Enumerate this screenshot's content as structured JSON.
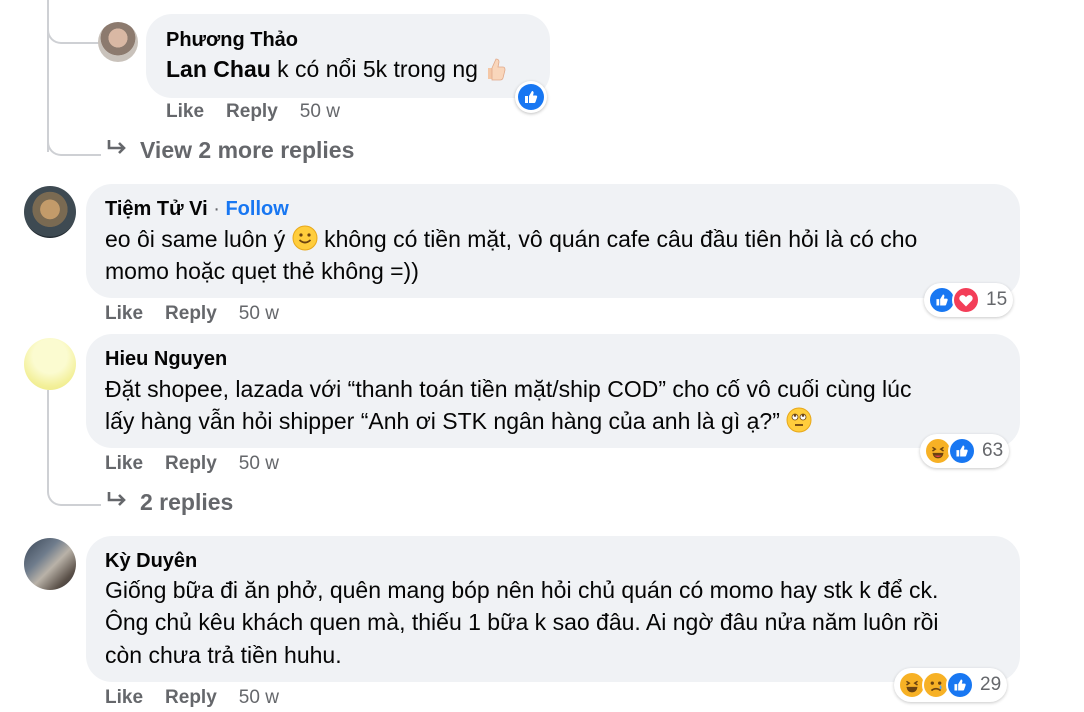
{
  "comments": {
    "reply_pt": {
      "author": "Phương Thảo",
      "mention": "Lan Chau",
      "text": "k có nổi 5k trong ng",
      "like": "Like",
      "reply": "Reply",
      "time": "50 w"
    },
    "view_more_pt": "View 2 more replies",
    "tiem": {
      "author": "Tiệm Tử Vi",
      "dot": "·",
      "follow": "Follow",
      "line1a": "eo ôi same luôn ý",
      "line1b": "không có tiền mặt, vô quán cafe câu đầu tiên hỏi là có cho",
      "line2": "momo hoặc quẹt thẻ không =))",
      "reaction_count": "15",
      "like": "Like",
      "reply": "Reply",
      "time": "50 w"
    },
    "hieu": {
      "author": "Hieu Nguyen",
      "line1": "Đặt shopee, lazada với “thanh toán tiền mặt/ship COD” cho cố vô cuối cùng lúc",
      "line2": "lấy hàng vẫn hỏi shipper “Anh ơi STK ngân hàng của anh là gì ạ?”",
      "reaction_count": "63",
      "like": "Like",
      "reply": "Reply",
      "time": "50 w"
    },
    "replies_hieu": "2 replies",
    "ky": {
      "author": "Kỳ Duyên",
      "line1": "Giống bữa đi ăn phở, quên mang bóp nên hỏi chủ quán có momo hay stk k để ck.",
      "line2": "Ông chủ kêu khách quen mà, thiếu 1 bữa k sao đâu. Ai ngờ đâu nửa năm luôn rồi",
      "line3": "còn chưa trả tiền huhu.",
      "reaction_count": "29",
      "like": "Like",
      "reply": "Reply",
      "time": "50 w"
    }
  },
  "colors": {
    "bubble": "#f0f2f5",
    "link": "#1877f2",
    "secondary": "#65676b",
    "like_blue": "#1877f2",
    "love_red": "#f33e58",
    "haha_yellow": "#f7b125"
  },
  "icons": [
    "reply-arrow-icon",
    "like-icon",
    "love-icon",
    "haha-icon",
    "sad-icon",
    "smile-emoji-icon",
    "eyeroll-emoji-icon",
    "thumbs-up-emoji-icon"
  ]
}
